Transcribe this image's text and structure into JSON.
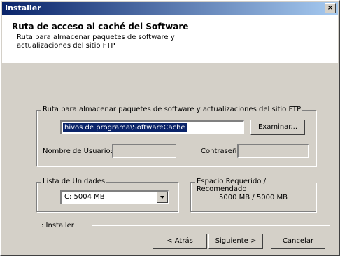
{
  "window": {
    "title": "Installer",
    "close_label": "×"
  },
  "header": {
    "title": "Ruta de acceso al caché del Software",
    "subtitle": "Ruta para almacenar paquetes de software y actualizaciones del sitio FTP"
  },
  "path_group": {
    "label": "Ruta para almacenar paquetes de software y actualizaciones del sitio FTP",
    "path_value": "hivos de programa\\SoftwareCache",
    "browse_button": "Examinar...",
    "username_label": "Nombre de Usuario:",
    "username_value": "",
    "password_label": "Contraseña:",
    "password_value": ""
  },
  "drive_group": {
    "label": "Lista de Unidades",
    "selected": "C:   5004 MB"
  },
  "space_group": {
    "label": "Espacio Requerido / Recomendado",
    "value": "5000 MB / 5000 MB"
  },
  "footer": {
    "brand": ": Installer",
    "back_button": "< Atrás",
    "next_button": "Siguiente >",
    "cancel_button": "Cancelar"
  }
}
